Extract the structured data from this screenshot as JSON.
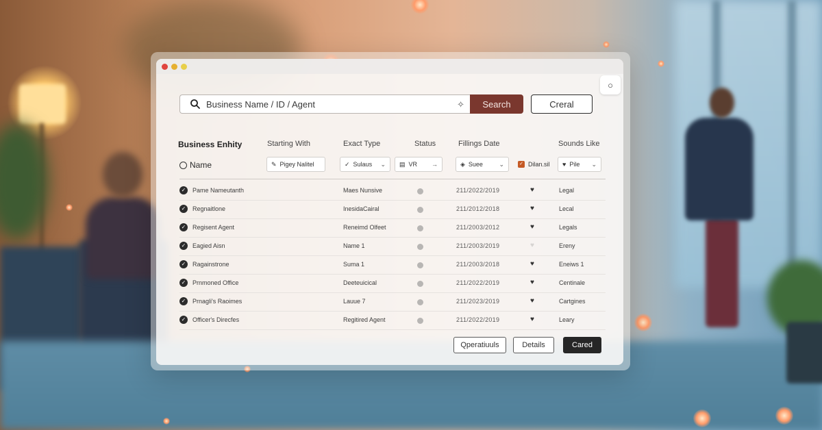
{
  "search": {
    "placeholder": "Business Name / ID / Agent",
    "button_label": "Search",
    "cancel_label": "Creral"
  },
  "headers": {
    "business_entity": "Business Enhity",
    "starting_with": "Starting With",
    "exact_type": "Exact Type",
    "status": "Status",
    "filings_date": "Fillings Date",
    "sounds_like": "Sounds Like"
  },
  "filters": {
    "name_label": "Name",
    "starting_with": "Pigey Nalitel",
    "exact_type": "Sulaus",
    "status": "VR",
    "filings_date": "Suee",
    "checkbox_label": "Dilan.sil",
    "sounds_like": "Pile"
  },
  "rows": [
    {
      "name": "Pame Nameutanth",
      "type": "Maes Nunsive",
      "date": "211/2022/2019",
      "favorite": true,
      "sounds_like": "Legal"
    },
    {
      "name": "Regnaitlone",
      "type": "InesidaCairal",
      "date": "211/2012/2018",
      "favorite": true,
      "sounds_like": "Lecal"
    },
    {
      "name": "Regisent Agent",
      "type": "Reneimd Olfeet",
      "date": "211/2003/2012",
      "favorite": true,
      "sounds_like": "Legals"
    },
    {
      "name": "Eagied Aisn",
      "type": "Name 1",
      "date": "211/2003/2019",
      "favorite": false,
      "sounds_like": "Ereny"
    },
    {
      "name": "Ragainstrone",
      "type": "Suma 1",
      "date": "211/2003/2018",
      "favorite": true,
      "sounds_like": "Eneiws 1"
    },
    {
      "name": "Prnmoned Office",
      "type": "Deeteuicical",
      "date": "211/2022/2019",
      "favorite": true,
      "sounds_like": "Centinale"
    },
    {
      "name": "Prnagli's Raoimes",
      "type": "Lauue 7",
      "date": "211/2023/2019",
      "favorite": true,
      "sounds_like": "Cartgines"
    },
    {
      "name": "Officer's Direcfes",
      "type": "Regitired Agent",
      "date": "211/2022/2019",
      "favorite": true,
      "sounds_like": "Leary"
    }
  ],
  "footer": {
    "operations_label": "Qperatiuuls",
    "details_label": "Details",
    "submit_label": "Cared"
  },
  "colors": {
    "search_button": "#7a372e",
    "primary_dark": "#262626",
    "checkbox_accent": "#c55a25"
  }
}
